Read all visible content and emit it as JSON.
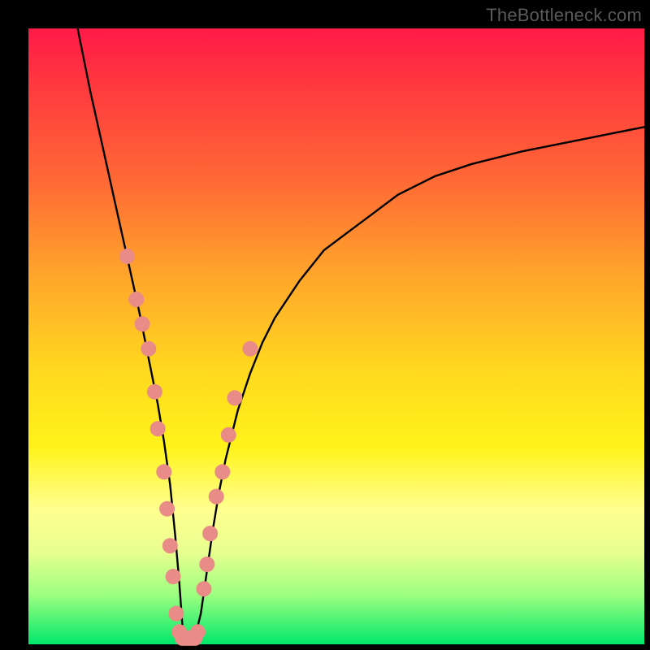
{
  "watermark": "TheBottleneck.com",
  "chart_data": {
    "type": "line",
    "title": "",
    "xlabel": "",
    "ylabel": "",
    "xlim": [
      0,
      100
    ],
    "ylim": [
      0,
      100
    ],
    "grid": false,
    "series": [
      {
        "name": "curve",
        "x": [
          8,
          10,
          12,
          14,
          16,
          18,
          20,
          21,
          22,
          23,
          23.8,
          24.5,
          25,
          25.5,
          26,
          27,
          28,
          29,
          30,
          31,
          32,
          34,
          36,
          38,
          40,
          44,
          48,
          52,
          56,
          60,
          66,
          72,
          80,
          90,
          100
        ],
        "values": [
          100,
          90,
          81,
          72,
          63,
          54,
          44,
          39,
          33,
          26,
          18,
          10,
          3,
          1,
          1,
          1,
          5,
          12,
          19,
          25,
          30,
          38,
          44,
          49,
          53,
          59,
          64,
          67,
          70,
          73,
          76,
          78,
          80,
          82,
          84
        ]
      }
    ],
    "markers": [
      {
        "x": 16.0,
        "y": 63
      },
      {
        "x": 17.5,
        "y": 56
      },
      {
        "x": 18.5,
        "y": 52
      },
      {
        "x": 19.5,
        "y": 48
      },
      {
        "x": 20.5,
        "y": 41
      },
      {
        "x": 21.0,
        "y": 35
      },
      {
        "x": 22.0,
        "y": 28
      },
      {
        "x": 22.5,
        "y": 22
      },
      {
        "x": 23.0,
        "y": 16
      },
      {
        "x": 23.5,
        "y": 11
      },
      {
        "x": 24.0,
        "y": 5
      },
      {
        "x": 24.5,
        "y": 2
      },
      {
        "x": 25.0,
        "y": 1
      },
      {
        "x": 25.5,
        "y": 1
      },
      {
        "x": 26.0,
        "y": 1
      },
      {
        "x": 26.5,
        "y": 1
      },
      {
        "x": 27.0,
        "y": 1
      },
      {
        "x": 27.5,
        "y": 2
      },
      {
        "x": 28.5,
        "y": 9
      },
      {
        "x": 29.0,
        "y": 13
      },
      {
        "x": 29.5,
        "y": 18
      },
      {
        "x": 30.5,
        "y": 24
      },
      {
        "x": 31.5,
        "y": 28
      },
      {
        "x": 32.5,
        "y": 34
      },
      {
        "x": 33.5,
        "y": 40
      },
      {
        "x": 36.0,
        "y": 48
      }
    ],
    "colors": {
      "curve": "#000000",
      "marker_fill": "#e98b86",
      "marker_stroke": "#e98b86"
    }
  }
}
